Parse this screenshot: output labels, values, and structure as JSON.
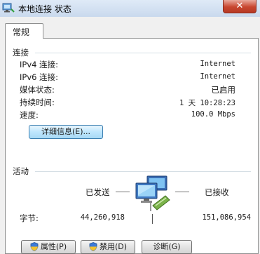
{
  "window": {
    "title": "本地连接 状态",
    "close_glyph": "✕"
  },
  "tabs": [
    {
      "label": "常规"
    }
  ],
  "connection": {
    "section_label": "连接",
    "rows": [
      {
        "label": "IPv4 连接:",
        "value": "Internet"
      },
      {
        "label": "IPv6 连接:",
        "value": "Internet"
      },
      {
        "label": "媒体状态:",
        "value": "已启用"
      },
      {
        "label": "持续时间:",
        "value": "1 天 10:28:23"
      },
      {
        "label": "速度:",
        "value": "100.0 Mbps"
      }
    ],
    "details_button": "详细信息(E)..."
  },
  "activity": {
    "section_label": "活动",
    "sent_label": "已发送",
    "received_label": "已接收",
    "bytes_label": "字节:",
    "bytes_sent": "44,260,918",
    "bytes_received": "151,086,954",
    "network_icon": "network-computers-icon"
  },
  "buttons": {
    "properties": "属性(P)",
    "disable": "禁用(D)",
    "diagnose": "诊断(G)"
  }
}
